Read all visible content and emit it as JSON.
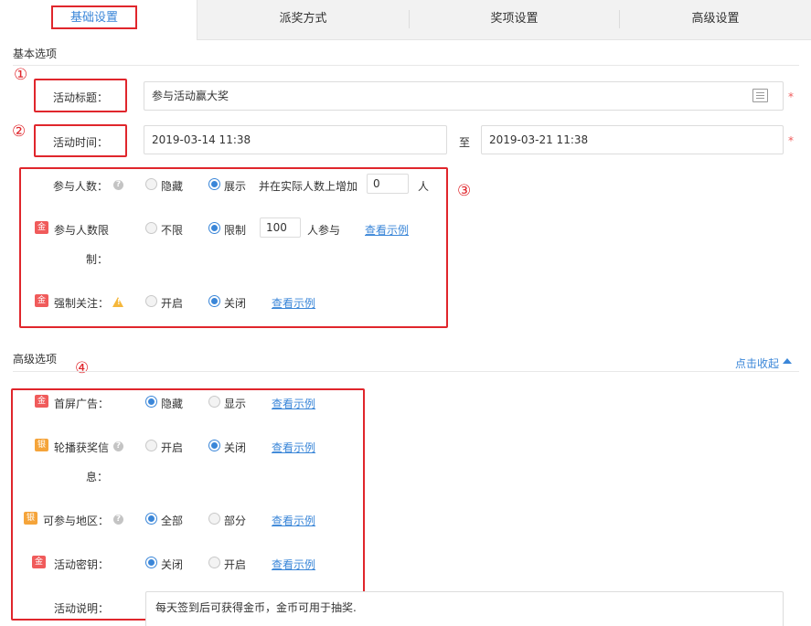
{
  "tabs": [
    {
      "label": "基础设置",
      "active": true
    },
    {
      "label": "派奖方式",
      "active": false
    },
    {
      "label": "奖项设置",
      "active": false
    },
    {
      "label": "高级设置",
      "active": false
    }
  ],
  "basic_section": {
    "title": "基本选项"
  },
  "annotations": {
    "n1": "①",
    "n2": "②",
    "n3": "③",
    "n4": "④"
  },
  "activity_title": {
    "label": "活动标题：",
    "value": "参与活动赢大奖",
    "required": "*",
    "icon": "template-icon"
  },
  "activity_time": {
    "label": "活动时间：",
    "start": "2019-03-14 11:38",
    "separator": "至",
    "end": "2019-03-21 11:38",
    "required": "*"
  },
  "participants": {
    "label": "参与人数：",
    "options": [
      "隐藏",
      "展示"
    ],
    "selected": "展示",
    "extra_prefix": "并在实际人数上增加",
    "extra_value": "0",
    "extra_unit": "人"
  },
  "participant_limit": {
    "badge": "金",
    "label_line1": "参与人数限",
    "label_line2": "制：",
    "options": [
      "不限",
      "限制"
    ],
    "selected": "限制",
    "limit_value": "100",
    "limit_unit": "人参与",
    "example_link": "查看示例"
  },
  "force_follow": {
    "badge": "金",
    "label": "强制关注：",
    "options": [
      "开启",
      "关闭"
    ],
    "selected": "关闭",
    "example_link": "查看示例"
  },
  "advanced_section": {
    "title": "高级选项",
    "collapse_label": "点击收起",
    "collapse_icon": "caret-up-icon"
  },
  "splash_ad": {
    "badge": "金",
    "label": "首屏广告：",
    "options": [
      "隐藏",
      "显示"
    ],
    "selected": "隐藏",
    "example_link": "查看示例"
  },
  "carousel_info": {
    "badge": "银",
    "label_line1": "轮播获奖信",
    "label_line2": "息：",
    "options": [
      "开启",
      "关闭"
    ],
    "selected": "关闭",
    "example_link": "查看示例"
  },
  "region": {
    "badge": "银",
    "label": "可参与地区：",
    "options": [
      "全部",
      "部分"
    ],
    "selected": "全部",
    "example_link": "查看示例"
  },
  "secret_key": {
    "badge": "金",
    "label": "活动密钥：",
    "options": [
      "关闭",
      "开启"
    ],
    "selected": "关闭",
    "example_link": "查看示例"
  },
  "description": {
    "label": "活动说明：",
    "value": "每天签到后可获得金币，金币可用于抽奖."
  },
  "colors": {
    "accent": "#3a86d8",
    "annotation": "#e0262c",
    "required": "#f05b5b",
    "gold_badge": "#f05b5b",
    "silver_badge": "#f5a43a"
  }
}
